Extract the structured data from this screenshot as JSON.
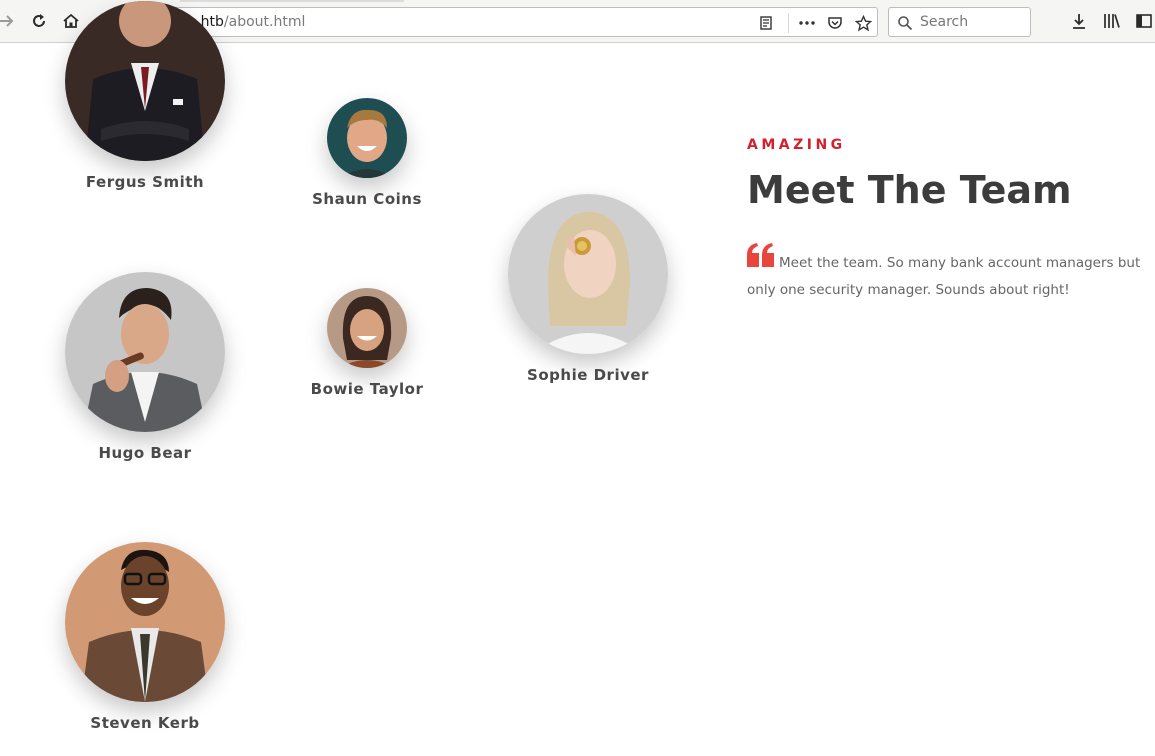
{
  "browser": {
    "url_host": "sauna.htb",
    "url_path": "/about.html",
    "search_placeholder": "Search"
  },
  "team_section": {
    "eyebrow": "AMAZING",
    "heading": "Meet The Team",
    "description": "Meet the team. So many bank account managers but only one security manager. Sounds about right!",
    "quote_icon": "quote-left-icon",
    "accent_color": "#e8453c",
    "members": [
      {
        "name": "Fergus Smith"
      },
      {
        "name": "Shaun Coins"
      },
      {
        "name": "Sophie Driver"
      },
      {
        "name": "Hugo Bear"
      },
      {
        "name": "Bowie Taylor"
      },
      {
        "name": "Steven Kerb"
      }
    ]
  }
}
